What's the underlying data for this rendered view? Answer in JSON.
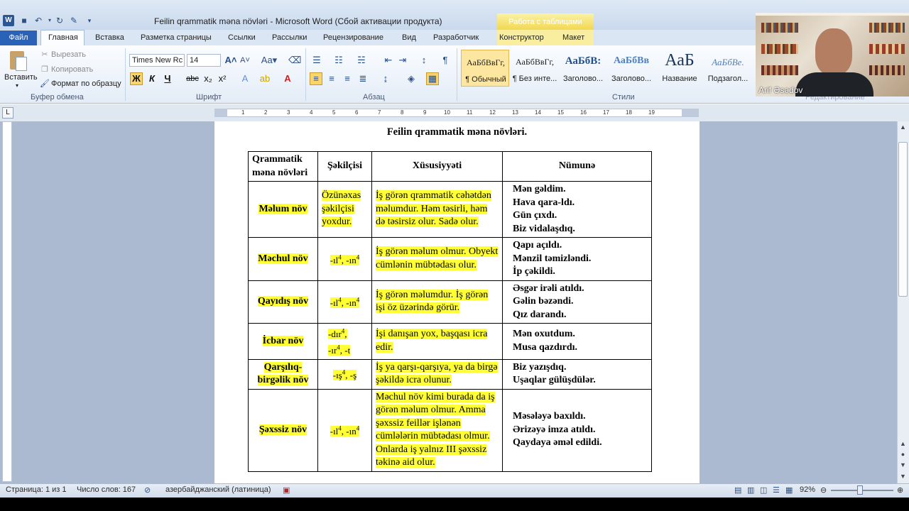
{
  "window": {
    "title": "Feilin qrammatik məna növləri  -  Microsoft Word (Сбой активации продукта)",
    "table_tools": "Работа с таблицами"
  },
  "tabs": {
    "file": "Файл",
    "home": "Главная",
    "insert": "Вставка",
    "layout": "Разметка страницы",
    "references": "Ссылки",
    "mailings": "Рассылки",
    "review": "Рецензирование",
    "view": "Вид",
    "developer": "Разработчик",
    "design": "Конструктор",
    "table_layout": "Макет"
  },
  "clipboard": {
    "paste": "Вставить",
    "cut": "Вырезать",
    "copy": "Копировать",
    "format_painter": "Формат по образцу",
    "label": "Буфер обмена"
  },
  "font": {
    "name": "Times New Rc",
    "size": "14",
    "label": "Шрифт",
    "bold": "Ж",
    "italic": "К",
    "underline": "Ч"
  },
  "paragraph": {
    "label": "Абзац"
  },
  "styles": {
    "label": "Стили",
    "items": [
      {
        "preview": "АаБбВвГг,",
        "name": "¶ Обычный"
      },
      {
        "preview": "АаБбВвГг,",
        "name": "¶ Без инте..."
      },
      {
        "preview": "АаБбВ:",
        "name": "Заголово..."
      },
      {
        "preview": "АаБбВв",
        "name": "Заголово..."
      },
      {
        "preview": "АаБ",
        "name": "Название"
      },
      {
        "preview": "АаБбВе.",
        "name": "Подзагол..."
      }
    ]
  },
  "editing_label": "Редактирование",
  "webcam": {
    "name": "Arif Əsədov"
  },
  "document": {
    "heading": "Feilin qrammatik məna növləri.",
    "table": {
      "headers": [
        "Qrammatik məna növləri",
        "Şəkilçisi",
        "Xüsusiyyəti",
        "Nümunə"
      ],
      "rows": [
        {
          "type": "Məlum növ",
          "suffix": "Özünəxas şəkilçisi yoxdur.",
          "feature": "İş görən qrammatik cəhətdən məlumdur. Həm təsirli, həm də təsirsiz olur. Sadə olur.",
          "examples": [
            "Mən gəldim.",
            "Hava qara-ldı.",
            "Gün çıxdı.",
            "Biz vidalaşdıq."
          ]
        },
        {
          "type": "Məchul növ",
          "suffix": "-ıl, -ın",
          "feature": "İş görən məlum olmur. Obyekt cümlənin mübtədası olur.",
          "examples": [
            "Qapı açıldı.",
            "Mənzil təmizləndi.",
            "İp çəkildi."
          ]
        },
        {
          "type": "Qayıdış növ",
          "suffix": "-ıl, -ın",
          "feature": "İş görən məlumdur. İş görən işi öz üzərində görür.",
          "examples": [
            "Əsgər irəli atıldı.",
            "Gəlin bəzəndi.",
            "Qız darandı."
          ]
        },
        {
          "type": "İcbar növ",
          "suffix_line1": "-dır,",
          "suffix_line2": "-ır, -t",
          "feature": "İşi danışan yox, başqası icra edir.",
          "examples": [
            "Mən oxutdum.",
            "Musa qazdırdı."
          ]
        },
        {
          "type": "Qarşılıq-birgəlik növ",
          "suffix": "-ış, -ş",
          "feature": "İş ya qarşı-qarşıya, ya da birgə şəkildə icra olunur.",
          "examples": [
            "Biz yazışdıq.",
            "Uşaqlar gülüşdülər."
          ]
        },
        {
          "type": "Şəxssiz növ",
          "suffix": "-ıl, -ın",
          "feature": "Məchul növ kimi burada da iş görən məlum olmur. Amma şəxssiz feillər işlənən cümlələrin mübtədası olmur. Onlarda iş yalnız III şəxssiz təkinə aid olur.",
          "examples": [
            "Məsələyə baxıldı.",
            "Ərizəyə imza atıldı.",
            "Qaydaya əməl edildi."
          ]
        }
      ],
      "superscript": "4"
    }
  },
  "statusbar": {
    "page": "Страница: 1 из 1",
    "words": "Число слов: 167",
    "language": "азербайджанский (латиница)",
    "zoom": "92%"
  },
  "colors": {
    "highlight": "#ffff33",
    "file_tab": "#2a62b8"
  }
}
